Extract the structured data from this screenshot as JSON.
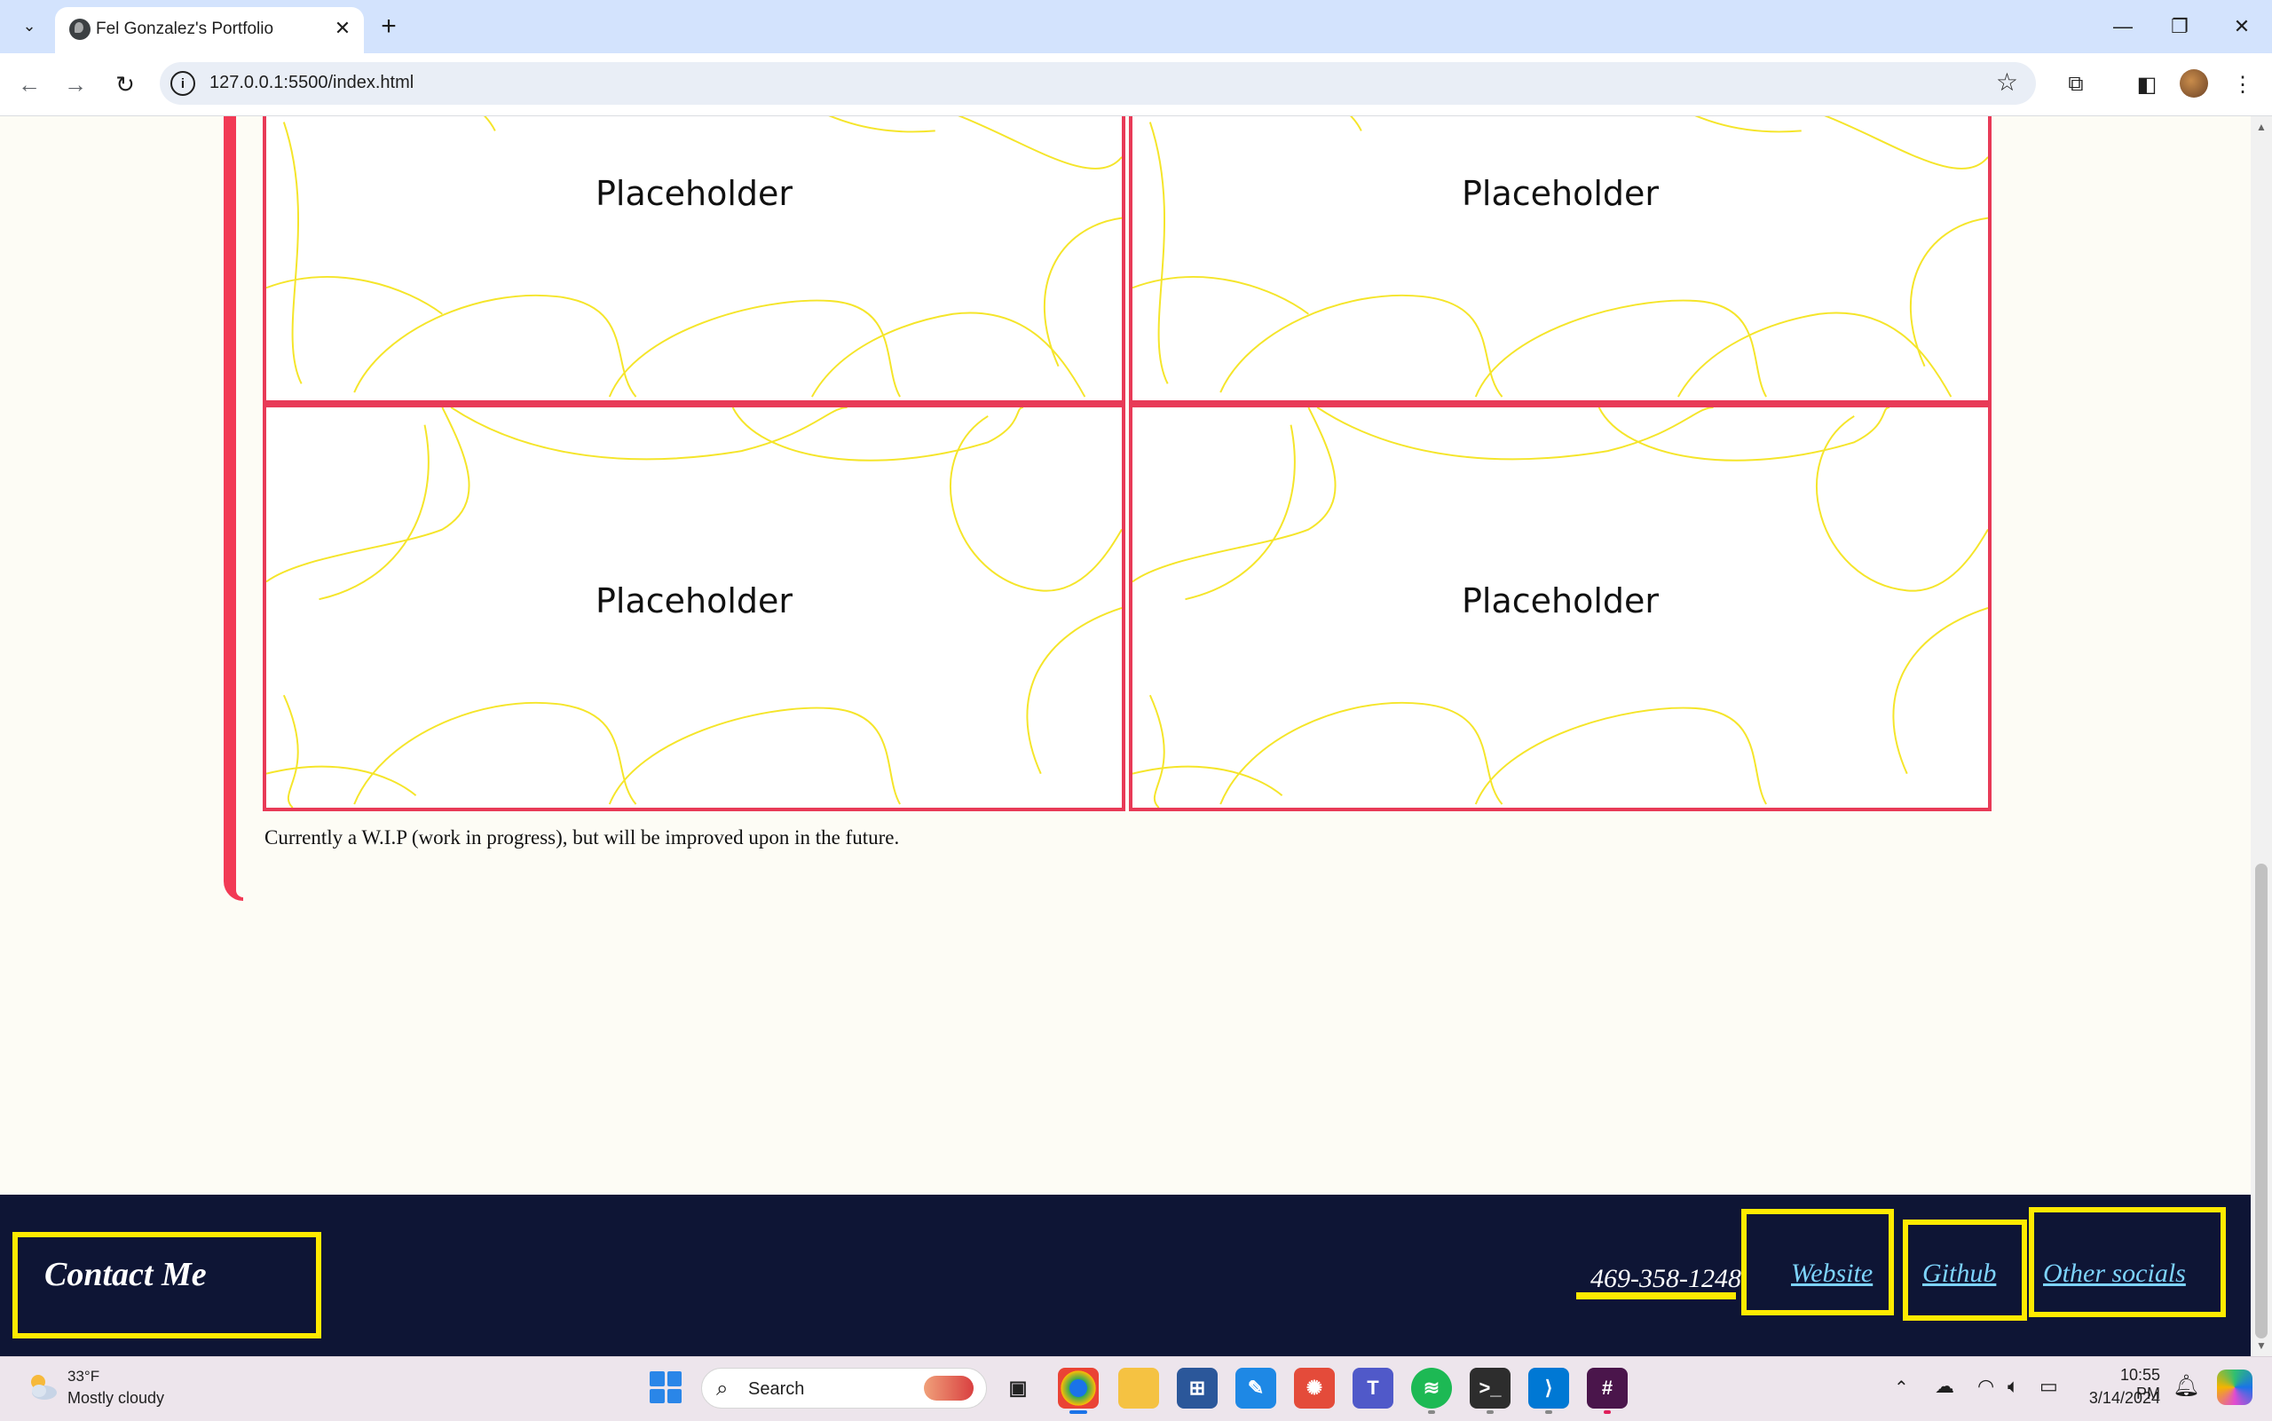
{
  "browser": {
    "tab_title": "Fel Gonzalez's Portfolio",
    "url": "127.0.0.1:5500/index.html"
  },
  "page": {
    "cells": [
      {
        "label": "Placeholder"
      },
      {
        "label": "Placeholder"
      },
      {
        "label": "Placeholder"
      },
      {
        "label": "Placeholder"
      }
    ],
    "note": "Currently a W.I.P (work in progress), but will be improved upon in the future."
  },
  "footer": {
    "contact_title": "Contact Me",
    "phone": "469-358-1248",
    "links": [
      {
        "label": "Website"
      },
      {
        "label": "Github"
      },
      {
        "label": "Other socials"
      }
    ]
  },
  "taskbar": {
    "weather_temp": "33°F",
    "weather_desc": "Mostly cloudy",
    "search_placeholder": "Search",
    "time": "10:55 PM",
    "date": "3/14/2024"
  },
  "colors": {
    "accent_red": "#e83a57",
    "footer_bg": "#0e1535",
    "highlight_yellow": "#ffea00",
    "link_blue": "#7dd3fc"
  }
}
